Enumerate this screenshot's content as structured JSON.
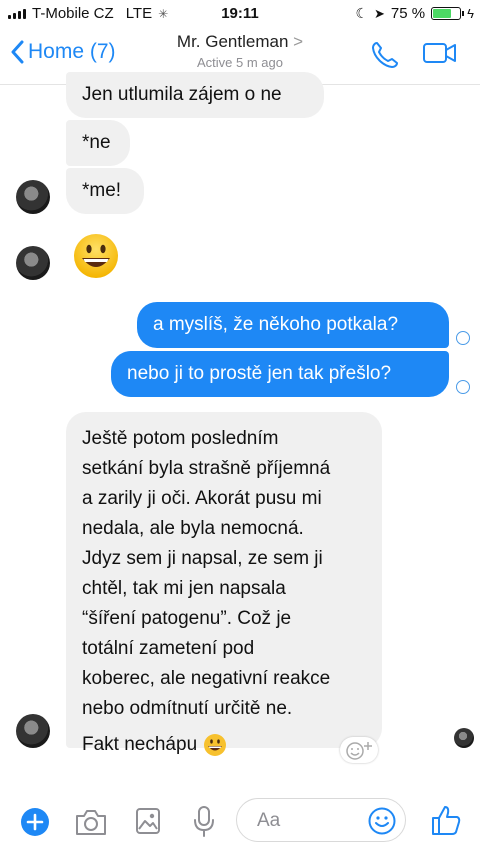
{
  "status_bar": {
    "carrier": "T-Mobile CZ",
    "network": "LTE",
    "time": "19:11",
    "battery": "75 %",
    "battery_level": 0.75
  },
  "header": {
    "back_label": "Home (7)",
    "contact_name": "Mr. Gentleman",
    "chevron": ">",
    "status": "Active 5 m ago"
  },
  "messages": [
    {
      "side": "in",
      "text": "Jen utlumila zájem o ne"
    },
    {
      "side": "in",
      "text": "*ne"
    },
    {
      "side": "in",
      "text": "*me!"
    },
    {
      "side": "in",
      "emoji": "grinning-face"
    },
    {
      "side": "out",
      "text": "a myslíš, že někoho potkala?"
    },
    {
      "side": "out",
      "text": "nebo ji to prostě jen tak přešlo?"
    },
    {
      "side": "in",
      "lines": [
        "Ještě potom posledním",
        "setkání byla strašně příjemná",
        "a zarily ji oči. Akorát pusu mi",
        "nedala, ale byla nemocná.",
        "Jdyz sem ji napsal, ze sem ji",
        "chtěl, tak mi jen napsala",
        "“šíření patogenu”. Což je",
        "totální zametení pod",
        "koberec, ale negativní reakce",
        "nebo odmítnutí určitě ne.",
        "Fakt nechápu"
      ]
    }
  ],
  "composer": {
    "placeholder": "Aa"
  },
  "icons": [
    "chevron-left-icon",
    "phone-icon",
    "video-icon",
    "plus-icon",
    "camera-icon",
    "gallery-icon",
    "microphone-icon",
    "emoji-icon",
    "like-icon",
    "add-reaction-icon"
  ],
  "colors": {
    "accent": "#1e88f5",
    "incoming_bubble": "#f0f0f0",
    "battery": "#4cd964"
  }
}
